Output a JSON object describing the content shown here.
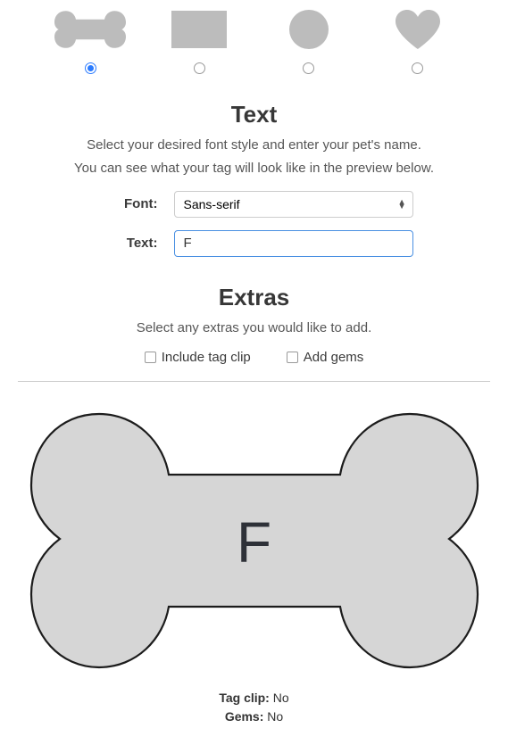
{
  "shapes": {
    "bone": {
      "selected": true
    },
    "rectangle": {
      "selected": false
    },
    "circle": {
      "selected": false
    },
    "heart": {
      "selected": false
    }
  },
  "section_text": {
    "heading": "Text",
    "desc1": "Select your desired font style and enter your pet's name.",
    "desc2": "You can see what your tag will look like in the preview below.",
    "font_label": "Font:",
    "text_label": "Text:",
    "font_options": [
      "Sans-serif"
    ],
    "font_selected": "Sans-serif",
    "text_value": "F"
  },
  "section_extras": {
    "heading": "Extras",
    "desc": "Select any extras you would like to add.",
    "include_tag_clip_label": "Include tag clip",
    "add_gems_label": "Add gems",
    "include_tag_clip": false,
    "add_gems": false
  },
  "preview": {
    "text": "F"
  },
  "summary": {
    "tag_clip_label": "Tag clip:",
    "tag_clip_value": "No",
    "gems_label": "Gems:",
    "gems_value": "No"
  }
}
